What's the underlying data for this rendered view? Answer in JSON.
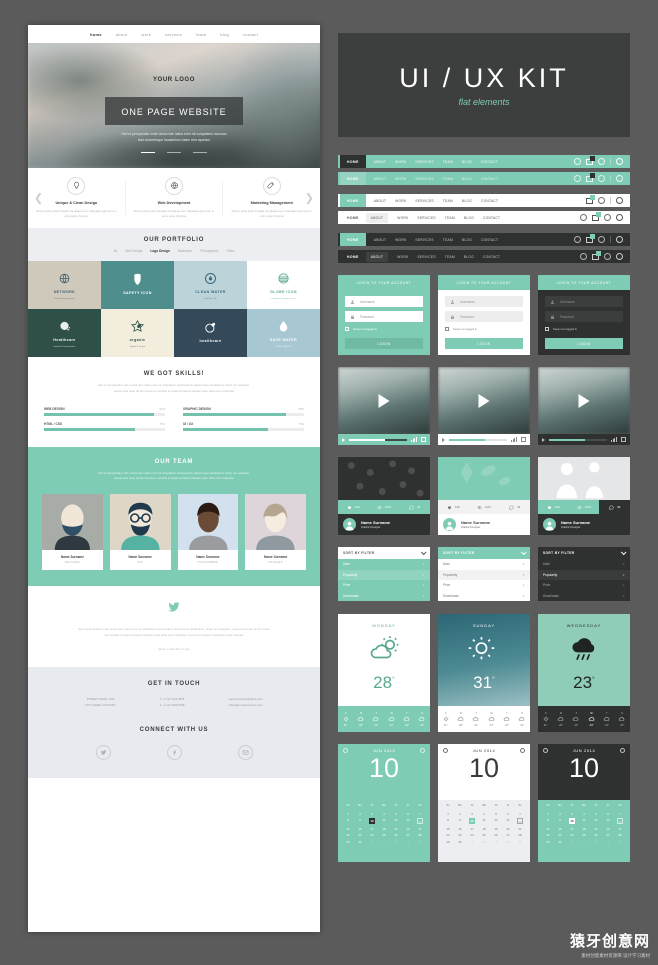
{
  "site": {
    "nav": [
      "home",
      "about",
      "work",
      "services",
      "team",
      "blog",
      "contact"
    ],
    "logo": "YOUR LOGO",
    "hero_banner": "ONE PAGE WEBSITE",
    "hero_sub_1": "Sed ut perspiciatis unde omnis iste natus error sit voluptatem accusan",
    "hero_sub_2": "tium doloremque laudantium totam rem aperiam",
    "features": [
      {
        "title": "Unique & Clean Design",
        "desc": "Donec pede justo fringilla vel aliquet nec vulputate eget arcu in enim justo rhoncus",
        "icon": "lightbulb-icon"
      },
      {
        "title": "Web Development",
        "desc": "Donec pede justo fringilla vel aliquet nec vulputate eget arcu in enim justo rhoncus",
        "icon": "globe-icon"
      },
      {
        "title": "Marketing Management",
        "desc": "Donec pede justo fringilla vel aliquet nec vulputate eget arcu in enim justo rhoncus",
        "icon": "rocket-icon"
      }
    ],
    "portfolio_title": "OUR PORTFOLIO",
    "portfolio_filters": [
      "All",
      "Web Design",
      "Logo Design",
      "Illustration",
      "Photography",
      "Video"
    ],
    "portfolio_active_filter": "Logo Design",
    "portfolio_items": [
      {
        "label": "NETWORK",
        "sub": "technology group",
        "bg": "#cfc9bb",
        "fg": "#41606e",
        "icon": "globe-wire-icon"
      },
      {
        "label": "SAFETY ICON",
        "sub": "",
        "bg": "#4e8f8d",
        "fg": "#ffffff",
        "icon": "shield-icon"
      },
      {
        "label": "CLEAN WATER",
        "sub": "healthy life",
        "bg": "#bcd3da",
        "fg": "#38697f",
        "icon": "droplet-circle-icon"
      },
      {
        "label": "GLOBE ICON",
        "sub": "company slogan here",
        "bg": "#ffffff",
        "fg": "#5aa88e",
        "icon": "globe-stripes-icon"
      },
      {
        "label": "Healthcare",
        "sub": "medical foundation",
        "bg": "#2f4f49",
        "fg": "#ffffff",
        "icon": "sphere-dots-icon"
      },
      {
        "label": "organic",
        "sub": "foods & fruits",
        "bg": "#f3eddd",
        "fg": "#2f4f49",
        "icon": "flower-icon"
      },
      {
        "label": "healthcare",
        "sub": "",
        "bg": "#34495a",
        "fg": "#ffffff",
        "icon": "leaf-circle-icon"
      },
      {
        "label": "SAVE WATER",
        "sub": "SAVE EARTH",
        "bg": "#a7c7d2",
        "fg": "#ffffff",
        "icon": "water-drop-icon"
      }
    ],
    "skills_title": "WE GOT SKILLS!",
    "skills_desc_1": "Sed ut perspiciatis unde omnis iste natus error sit voluptatem accusantium doloremque laudantium totam rem aperiam,",
    "skills_desc_2": "eaque ipsa quae ab illo inventore veritatis et quasi architecto beatae vitae dicta sunt explicabo",
    "skills": [
      {
        "name": "WEB DESIGN",
        "percent": "91%",
        "value": 91
      },
      {
        "name": "GRAPHIC DESIGN",
        "percent": "85%",
        "value": 85
      },
      {
        "name": "HTML / CSS",
        "percent": "75%",
        "value": 75
      },
      {
        "name": "UI / UX",
        "percent": "70%",
        "value": 70
      }
    ],
    "team_title": "OUR TEAM",
    "team_desc_1": "Sed ut perspiciatis unde omnis iste natus error sit voluptatem accusantium doloremque laudantium totam rem aperiam,",
    "team_desc_2": "eaque ipsa quae ab illo inventore veritatis et quasi architecto beatae vitae dicta sunt explicabo",
    "team": [
      {
        "name": "Name Surname",
        "role": "DESIGNER"
      },
      {
        "name": "Name Surname",
        "role": "SEO"
      },
      {
        "name": "Name Surname",
        "role": "PROGRAMMER"
      },
      {
        "name": "Name Surname",
        "role": "MANAGER"
      }
    ],
    "tweet_text_1": "Sed ut perspiciatis unde omnis iste natus error sit voluptatem accusantium doloremque laudantium, totam rem aperiam, eaque ipsa quae ab illo invent",
    "tweet_text_2": "ore veritatis et quasi architecto beatae vitae dicta sunt explicabo, nemo enim ipsam voluptatem quia voluptas",
    "tweet_meta": "@twit, 3 days 48 min ago",
    "contact_title": "GET IN TOUCH",
    "contact_cols": [
      [
        "STREET NAME, 1234",
        "CITY NAME, COUNTRY"
      ],
      [
        "T: +1 (2) 1234 5678",
        "F: +1 (2) 2345 6789"
      ],
      [
        "name.surname@office.com",
        "office@companyname.com"
      ]
    ],
    "connect_title": "CONNECT WITH US",
    "social": [
      "twitter-icon",
      "facebook-icon",
      "email-icon"
    ]
  },
  "kit": {
    "title": "UI / UX KIT",
    "subtitle": "flat elements",
    "navbar_items": [
      "HOME",
      "ABOUT",
      "WORK",
      "SERVICES",
      "TEAM",
      "BLOG",
      "CONTACT"
    ],
    "navbar_active": "HOME",
    "navbars": [
      {
        "bg": "#7ecbb6",
        "fg": "#ffffff",
        "home_bg": "#2f3130",
        "home_fg": "#ffffff"
      },
      {
        "bg": "#7ecbb6",
        "fg": "#e9f7f2",
        "home_bg": "#95d4c2",
        "home_fg": "#ffffff"
      },
      {
        "bg": "#ffffff",
        "fg": "#555555",
        "home_bg": "#7ecbb6",
        "home_fg": "#ffffff"
      },
      {
        "bg": "#ffffff",
        "fg": "#555555",
        "home_bg": "#eeeeee",
        "home_fg": "#555555"
      },
      {
        "bg": "#2f3130",
        "fg": "#cccccc",
        "home_bg": "#7ecbb6",
        "home_fg": "#ffffff"
      },
      {
        "bg": "#2f3130",
        "fg": "#cccccc",
        "home_bg": "#3f4140",
        "home_fg": "#ffffff"
      }
    ],
    "login": {
      "header": "LOGIN TO YOUR ACCOUNT",
      "username_placeholder": "Username",
      "password_placeholder": "Password",
      "keep_logged": "Keep me logged in",
      "button": "LOGIN",
      "variants": [
        {
          "body_bg": "#7ecbb6",
          "field_bg": "#ffffff",
          "field_fg": "#9a9a9a",
          "text": "#ffffff",
          "btn_bg": "#6fb9a5",
          "btn_fg": "#ffffff"
        },
        {
          "body_bg": "#ffffff",
          "field_bg": "#ededed",
          "field_fg": "#9a9a9a",
          "text": "#777777",
          "btn_bg": "#7ecbb6",
          "btn_fg": "#ffffff"
        },
        {
          "body_bg": "#2f3130",
          "field_bg": "#3c3e3d",
          "field_fg": "#8d8d8d",
          "text": "#cccccc",
          "btn_bg": "#7ecbb6",
          "btn_fg": "#ffffff"
        }
      ]
    },
    "video": {
      "variants": [
        {
          "bar_bg": "#7ecbb6",
          "fg": "#ffffff",
          "track": "#3d4b49",
          "fill": "#ffffff",
          "progress": 62
        },
        {
          "bar_bg": "#ffffff",
          "fg": "#8a8a8a",
          "track": "#e2e2e2",
          "fill": "#7ecbb6",
          "progress": 62
        },
        {
          "bar_bg": "#2f3130",
          "fg": "#bbbbbb",
          "track": "#4a4c4b",
          "fill": "#7ecbb6",
          "progress": 62
        }
      ]
    },
    "profile_card": {
      "likes": "136",
      "views": "1137",
      "comments": "43",
      "name": "Name Surname",
      "role": "Graphic Designer",
      "variants": [
        {
          "img_bg": "#2f3130",
          "stats_bg": "#7ecbb6",
          "stats_fg": "#ffffff",
          "foot_bg": "#2f3130",
          "foot_fg": "#ffffff"
        },
        {
          "img_bg": "#7ecbb6",
          "stats_bg": "#f2f2f2",
          "stats_fg": "#777777",
          "foot_bg": "#ffffff",
          "foot_fg": "#444444"
        },
        {
          "img_bg": "#e4e6e8",
          "stats_bg": "#7ecbb6",
          "stats_fg": "#ffffff",
          "foot_bg": "#2f3130",
          "foot_fg": "#ffffff"
        }
      ]
    },
    "sort_filter": {
      "header": "SORT BY FILTER",
      "options": [
        "Date",
        "Popularity",
        "Price",
        "Downloads"
      ],
      "variants": [
        {
          "head_bg": "#ffffff",
          "head_fg": "#555555",
          "row_bg": "#7ecbb6",
          "row_fg": "#ffffff",
          "alt_bg": "#8fd3c0"
        },
        {
          "head_bg": "#7ecbb6",
          "head_fg": "#ffffff",
          "row_bg": "#ffffff",
          "row_fg": "#777777",
          "alt_bg": "#f2f2f2"
        },
        {
          "head_bg": "#2f3130",
          "head_fg": "#ffffff",
          "row_bg": "#2f3130",
          "row_fg": "#aaaaaa",
          "alt_bg": "#3a3c3b"
        }
      ]
    },
    "weather": [
      {
        "day": "MONDAY",
        "temp": "28",
        "icon": "cloud-sun-icon",
        "top_bg": "#ffffff",
        "top_fg": "#5aa88e",
        "fc_bg": "#7ecbb6",
        "fc_fg": "#ffffff",
        "forecast": [
          {
            "d": "S",
            "t": "31°",
            "i": "sun"
          },
          {
            "d": "M",
            "t": "28°",
            "i": "cloud"
          },
          {
            "d": "T",
            "t": "24°",
            "i": "cloud"
          },
          {
            "d": "W",
            "t": "23°",
            "i": "cloud"
          },
          {
            "d": "T",
            "t": "24°",
            "i": "cloud"
          },
          {
            "d": "S",
            "t": "20°",
            "i": "cloud"
          }
        ]
      },
      {
        "day": "SUNDAY",
        "temp": "31",
        "icon": "sun-cloud-icon",
        "top_bg": "#2e6b78",
        "top_fg": "#ffffff",
        "fc_bg": "#ffffff",
        "fc_fg": "#8a8a8a",
        "forecast": [
          {
            "d": "S",
            "t": "31°",
            "i": "sun"
          },
          {
            "d": "M",
            "t": "28°",
            "i": "cloud"
          },
          {
            "d": "T",
            "t": "24°",
            "i": "cloud"
          },
          {
            "d": "W",
            "t": "23°",
            "i": "cloud"
          },
          {
            "d": "T",
            "t": "24°",
            "i": "cloud"
          },
          {
            "d": "S",
            "t": "20°",
            "i": "cloud"
          }
        ]
      },
      {
        "day": "WEDNESDAY",
        "temp": "23",
        "icon": "rain-cloud-icon",
        "top_bg": "#8fcdb9",
        "top_fg": "#1f2322",
        "fc_bg": "#2f3130",
        "fc_fg": "#b5b5b5",
        "forecast": [
          {
            "d": "S",
            "t": "31°",
            "i": "sun"
          },
          {
            "d": "M",
            "t": "28°",
            "i": "cloud"
          },
          {
            "d": "T",
            "t": "24°",
            "i": "cloud"
          },
          {
            "d": "W",
            "t": "23°",
            "i": "cloud"
          },
          {
            "d": "T",
            "t": "24°",
            "i": "cloud"
          },
          {
            "d": "S",
            "t": "20°",
            "i": "cloud"
          }
        ]
      }
    ],
    "calendar": {
      "month": "JUN 2014",
      "big_day": "10",
      "weekdays": [
        "Su",
        "Mo",
        "Tu",
        "We",
        "Th",
        "Fr",
        "Sa"
      ],
      "weeks": [
        [
          "1",
          "2",
          "3",
          "4",
          "5",
          "6",
          "7"
        ],
        [
          "8",
          "9",
          "10",
          "11",
          "12",
          "13",
          "14"
        ],
        [
          "15",
          "16",
          "17",
          "18",
          "19",
          "20",
          "21"
        ],
        [
          "22",
          "23",
          "24",
          "25",
          "26",
          "27",
          "28"
        ],
        [
          "29",
          "30",
          "1",
          "2",
          "3",
          "4",
          "5"
        ]
      ],
      "selected": "10",
      "outlined": "14",
      "variants": [
        {
          "top_bg": "#7ecbb6",
          "top_fg": "#ffffff",
          "body_bg": "#7ecbb6",
          "body_fg": "#ffffff",
          "sel_bg": "#2f3130",
          "sel_fg": "#ffffff"
        },
        {
          "top_bg": "#ffffff",
          "top_fg": "#3b3b3b",
          "body_bg": "#eceef1",
          "body_fg": "#777777",
          "sel_bg": "#7ecbb6",
          "sel_fg": "#ffffff"
        },
        {
          "top_bg": "#2f3130",
          "top_fg": "#ffffff",
          "body_bg": "#7ecbb6",
          "body_fg": "#ffffff",
          "sel_bg": "#ffffff",
          "sel_fg": "#2f3130"
        }
      ]
    }
  },
  "watermark": {
    "line1": "猿牙创意网",
    "line2": "素材创意素材资源库 设计学习素材"
  }
}
